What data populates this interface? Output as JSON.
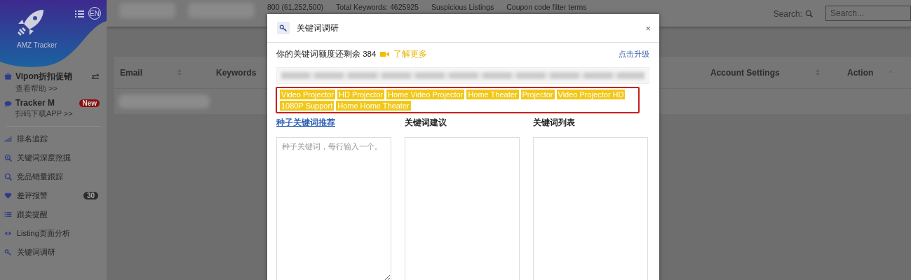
{
  "sidebar": {
    "brand": "AMZ Tracker",
    "lang": "EN",
    "promos": [
      {
        "title": "Vipon折扣促销",
        "sub": "查看帮助 >>"
      },
      {
        "title": "Tracker M",
        "sub": "扫码下载APP >>",
        "badge": "New"
      }
    ],
    "items": [
      {
        "label": "排名追踪"
      },
      {
        "label": "关键词深度挖掘"
      },
      {
        "label": "竞品销量跟踪"
      },
      {
        "label": "差评报警",
        "count": "30"
      },
      {
        "label": "跟卖提醒"
      },
      {
        "label": "Listing页面分析"
      },
      {
        "label": "关键词调研"
      }
    ]
  },
  "header": {
    "stats": [
      "800 (61,252,500)",
      "Total Keywords: 4625925",
      "Suspicious Listings",
      "Coupon code filter terms"
    ],
    "search_label": "Search:",
    "search_placeholder": "Search..."
  },
  "table": {
    "columns": [
      {
        "label": "Email"
      },
      {
        "label": "Keywords"
      },
      {
        "label": "Account Settings"
      },
      {
        "label": "Action"
      }
    ]
  },
  "modal": {
    "title": "关键词调研",
    "close": "×",
    "quota": "你的关键词额度还剩余 384",
    "learn_more": "了解更多",
    "upgrade": "点击升级",
    "tags": [
      "Video Projector",
      "HD Projector",
      "Home Video Projector",
      "Home Theater",
      "Projector",
      "Video Projector HD",
      "1080P Support",
      "Home Home Theater"
    ],
    "columns": [
      {
        "label": "种子关键词推荐",
        "link": true,
        "placeholder": "种子关键词，每行输入一个。"
      },
      {
        "label": "关键词建议",
        "link": false
      },
      {
        "label": "关键词列表",
        "link": false
      }
    ]
  }
}
